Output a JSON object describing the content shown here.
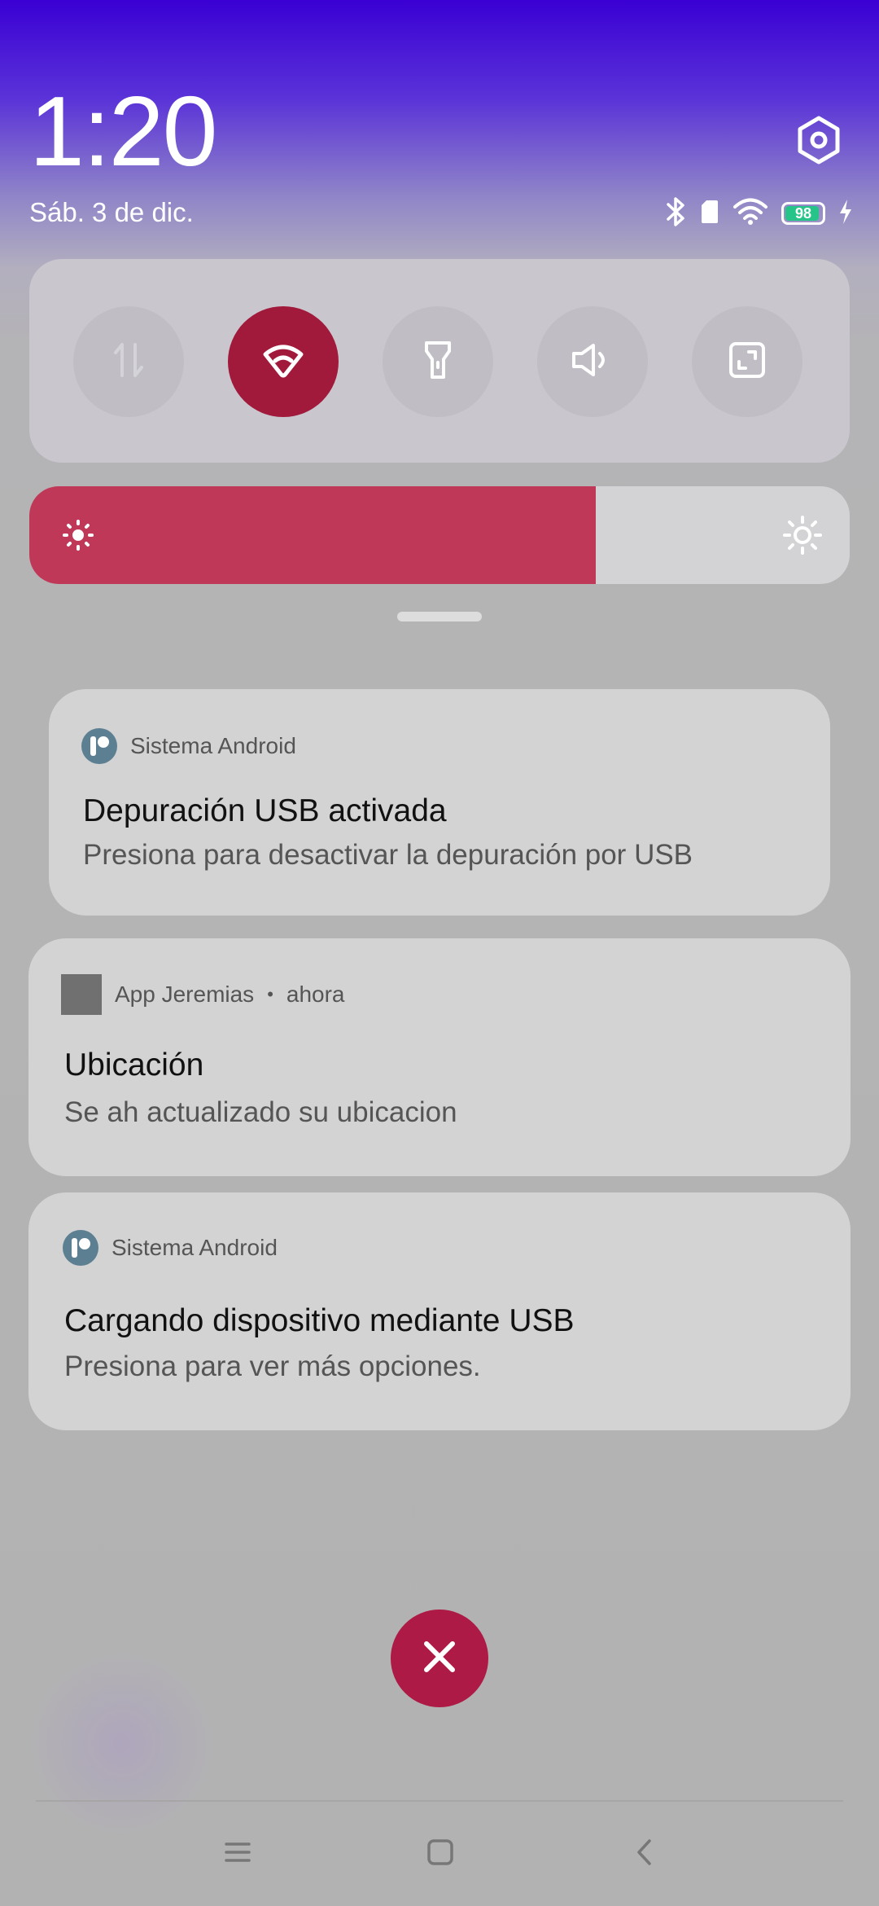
{
  "header": {
    "time": "1:20",
    "date": "Sáb. 3 de dic.",
    "battery_level": "98"
  },
  "icons": [
    "settings-icon",
    "bluetooth-icon",
    "sim-icon",
    "wifi-icon",
    "battery-icon",
    "charging-icon",
    "data-transfer-icon",
    "hotspot-icon",
    "flashlight-icon",
    "sound-icon",
    "screenshot-icon",
    "brightness-low-icon",
    "brightness-high-icon",
    "close-icon",
    "menu-icon",
    "home-icon",
    "back-icon"
  ],
  "quick_settings": {
    "tiles": [
      "mobile-data",
      "hotspot",
      "flashlight",
      "sound",
      "screenshot"
    ],
    "active_tile": "hotspot"
  },
  "brightness": {
    "level": 0.69
  },
  "notifications": [
    {
      "app": "Sistema Android",
      "title": "Depuración USB activada",
      "body": "Presiona para desactivar la depuración por USB"
    },
    {
      "app": "App Jeremias",
      "time": "ahora",
      "title": "Ubicación",
      "body": "Se ah actualizado su ubicacion"
    },
    {
      "app": "Sistema Android",
      "title": "Cargando dispositivo mediante USB",
      "body": "Presiona para ver más opciones."
    }
  ],
  "colors": {
    "accent": "#a11a3b",
    "brightness_fill": "#c03858",
    "close_button": "#ad1a45",
    "battery_fill": "#27c48a"
  }
}
